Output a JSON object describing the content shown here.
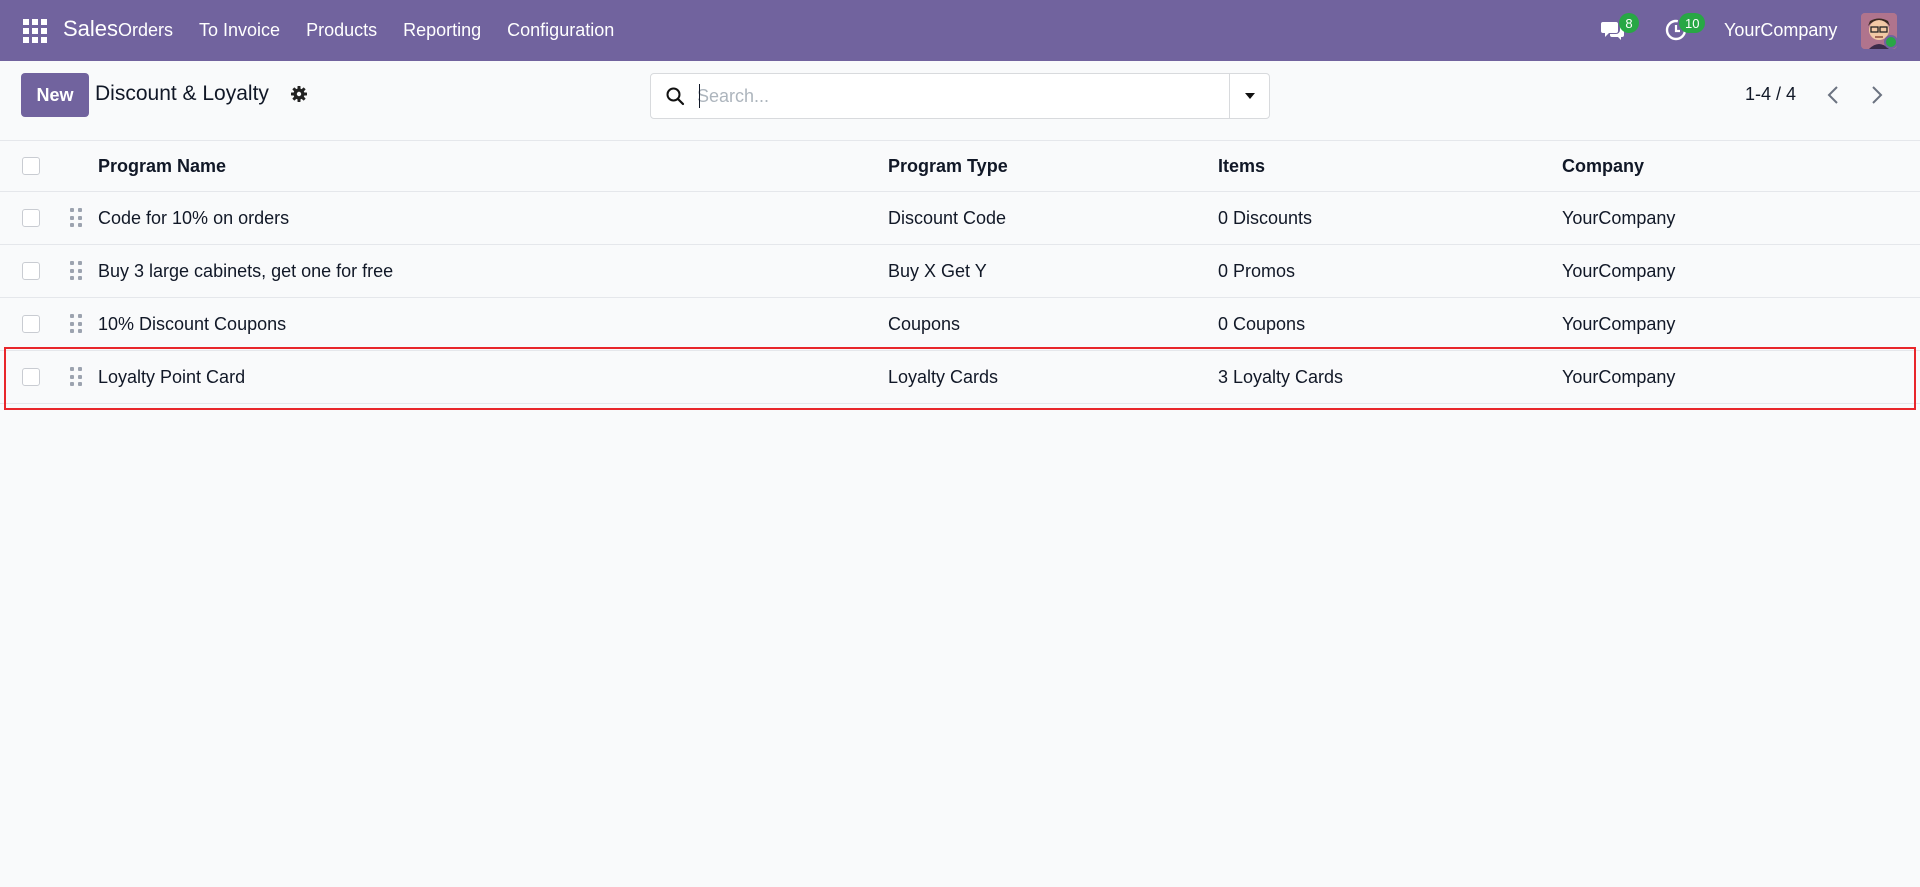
{
  "navbar": {
    "brand": "Sales",
    "menu": [
      "Orders",
      "To Invoice",
      "Products",
      "Reporting",
      "Configuration"
    ],
    "messages_count": "8",
    "activities_count": "10",
    "company": "YourCompany",
    "bg_color": "#71639e"
  },
  "control_panel": {
    "new_label": "New",
    "breadcrumb": "Discount & Loyalty",
    "search_placeholder": "Search...",
    "pager": "1-4 / 4"
  },
  "table": {
    "headers": {
      "name": "Program Name",
      "type": "Program Type",
      "items": "Items",
      "company": "Company"
    },
    "rows": [
      {
        "name": "Code for 10% on orders",
        "type": "Discount Code",
        "items": "0 Discounts",
        "company": "YourCompany"
      },
      {
        "name": "Buy 3 large cabinets, get one for free",
        "type": "Buy X Get Y",
        "items": "0 Promos",
        "company": "YourCompany"
      },
      {
        "name": "10% Discount Coupons",
        "type": "Coupons",
        "items": "0 Coupons",
        "company": "YourCompany"
      },
      {
        "name": "Loyalty Point Card",
        "type": "Loyalty Cards",
        "items": "3 Loyalty Cards",
        "company": "YourCompany"
      }
    ]
  },
  "highlight_color": "#e8262b"
}
